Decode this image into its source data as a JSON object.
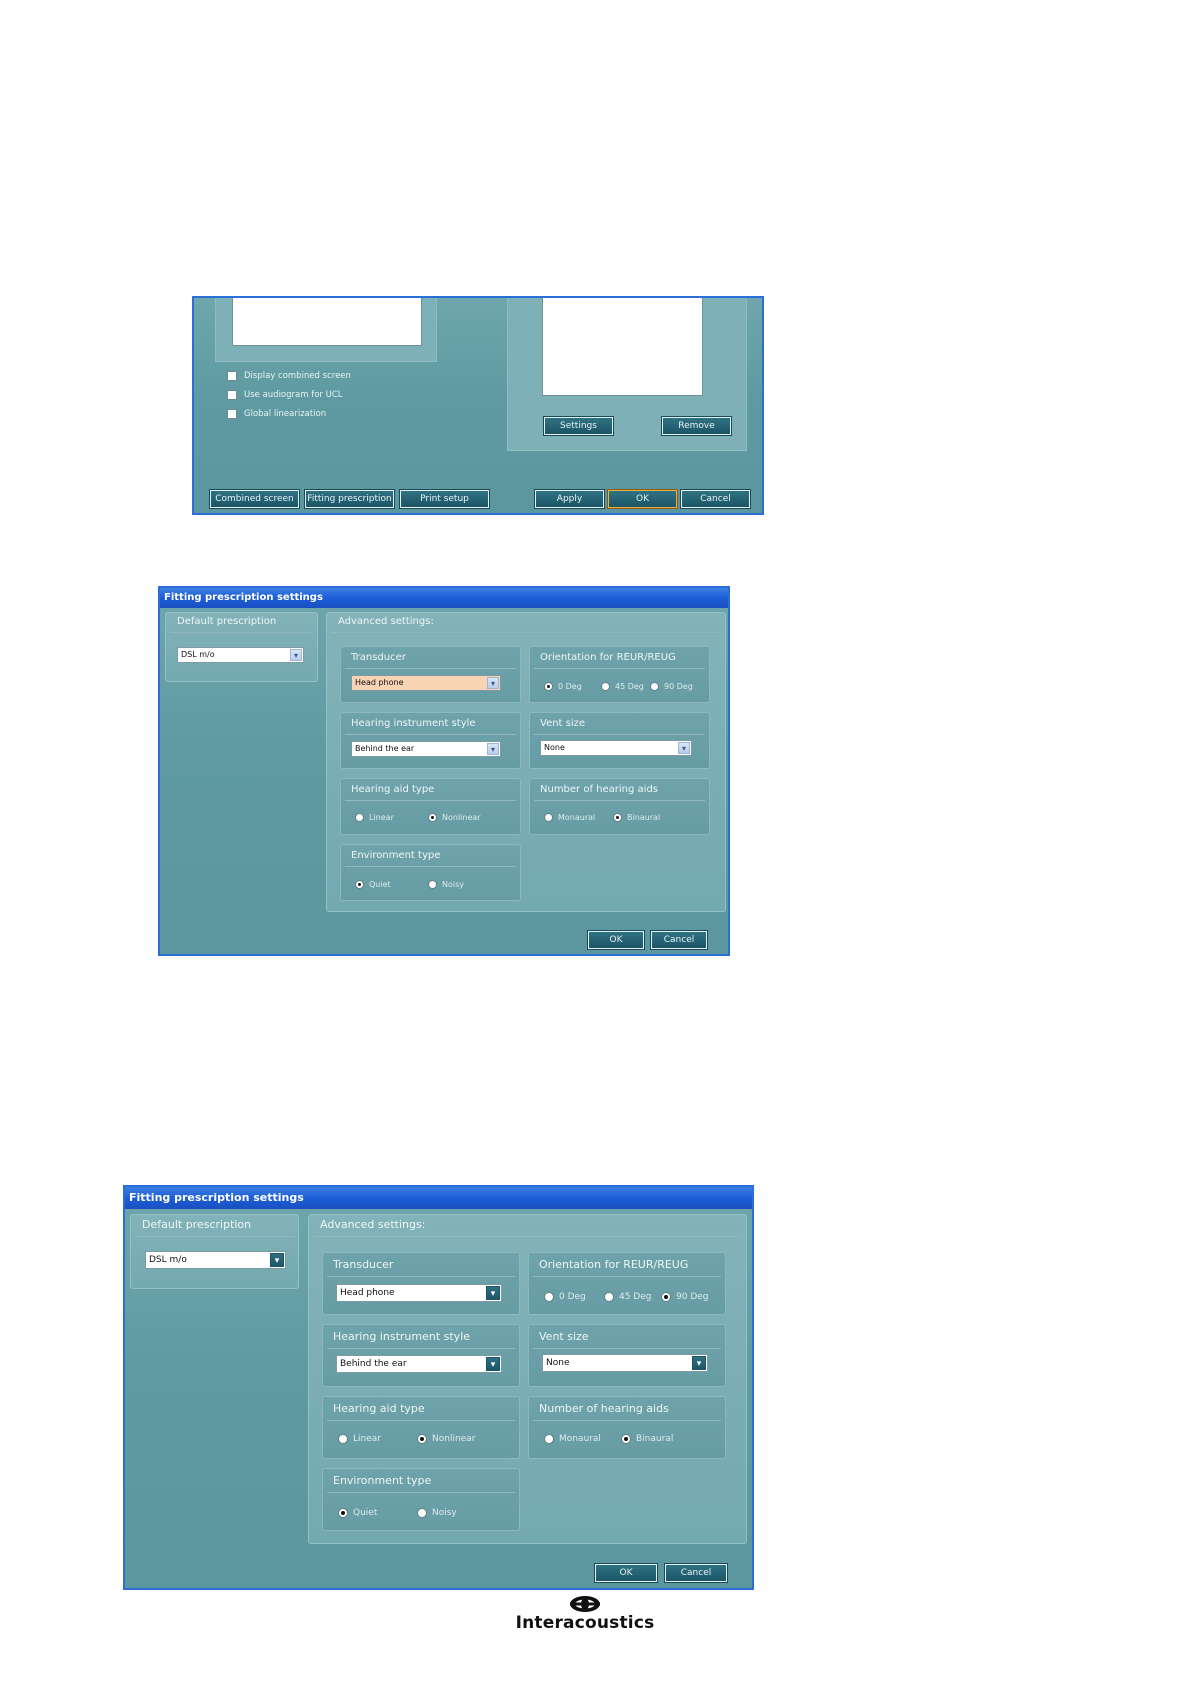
{
  "dialog1": {
    "checkboxes": [
      {
        "label": "Display combined screen",
        "checked": false
      },
      {
        "label": "Use audiogram for UCL",
        "checked": false
      },
      {
        "label": "Global linearization",
        "checked": false
      }
    ],
    "buttons": {
      "settings": "Settings",
      "remove": "Remove",
      "combined_screen": "Combined screen",
      "fitting_prescription": "Fitting prescription",
      "print_setup": "Print setup",
      "apply": "Apply",
      "ok": "OK",
      "cancel": "Cancel"
    }
  },
  "dialog2": {
    "title": "Fitting prescription settings",
    "default_prescription": {
      "label": "Default prescription",
      "value": "DSL m/o"
    },
    "advanced_label": "Advanced settings:",
    "transducer": {
      "label": "Transducer",
      "value": "Head phone"
    },
    "orientation": {
      "label": "Orientation for REUR/REUG",
      "options": [
        "0 Deg",
        "45 Deg",
        "90 Deg"
      ],
      "selected": "0 Deg"
    },
    "hearing_instrument_style": {
      "label": "Hearing instrument style",
      "value": "Behind the ear"
    },
    "vent_size": {
      "label": "Vent size",
      "value": "None"
    },
    "hearing_aid_type": {
      "label": "Hearing aid type",
      "options": [
        "Linear",
        "Nonlinear"
      ],
      "selected": "Nonlinear"
    },
    "number_of_hearing_aids": {
      "label": "Number of hearing aids",
      "options": [
        "Monaural",
        "Binaural"
      ],
      "selected": "Binaural"
    },
    "environment_type": {
      "label": "Environment type",
      "options": [
        "Quiet",
        "Noisy"
      ],
      "selected": "Quiet"
    },
    "buttons": {
      "ok": "OK",
      "cancel": "Cancel"
    }
  },
  "dialog3": {
    "title": "Fitting prescription settings",
    "default_prescription": {
      "label": "Default prescription",
      "value": "DSL m/o"
    },
    "advanced_label": "Advanced settings:",
    "transducer": {
      "label": "Transducer",
      "value": "Head phone"
    },
    "orientation": {
      "label": "Orientation for REUR/REUG",
      "options": [
        "0 Deg",
        "45 Deg",
        "90 Deg"
      ],
      "selected": "90 Deg"
    },
    "hearing_instrument_style": {
      "label": "Hearing instrument style",
      "value": "Behind the ear"
    },
    "vent_size": {
      "label": "Vent size",
      "value": "None"
    },
    "hearing_aid_type": {
      "label": "Hearing aid type",
      "options": [
        "Linear",
        "Nonlinear"
      ],
      "selected": "Nonlinear"
    },
    "number_of_hearing_aids": {
      "label": "Number of hearing aids",
      "options": [
        "Monaural",
        "Binaural"
      ],
      "selected": "Binaural"
    },
    "environment_type": {
      "label": "Environment type",
      "options": [
        "Quiet",
        "Noisy"
      ],
      "selected": "Quiet"
    },
    "buttons": {
      "ok": "OK",
      "cancel": "Cancel"
    }
  },
  "footer": {
    "logo_text": "Interacoustics"
  },
  "colors": {
    "teal": "#5f9aa2",
    "title_blue": "#1d5dd8",
    "focus_orange": "#f0b13c",
    "transducer_highlight": "#f8d3b4"
  }
}
